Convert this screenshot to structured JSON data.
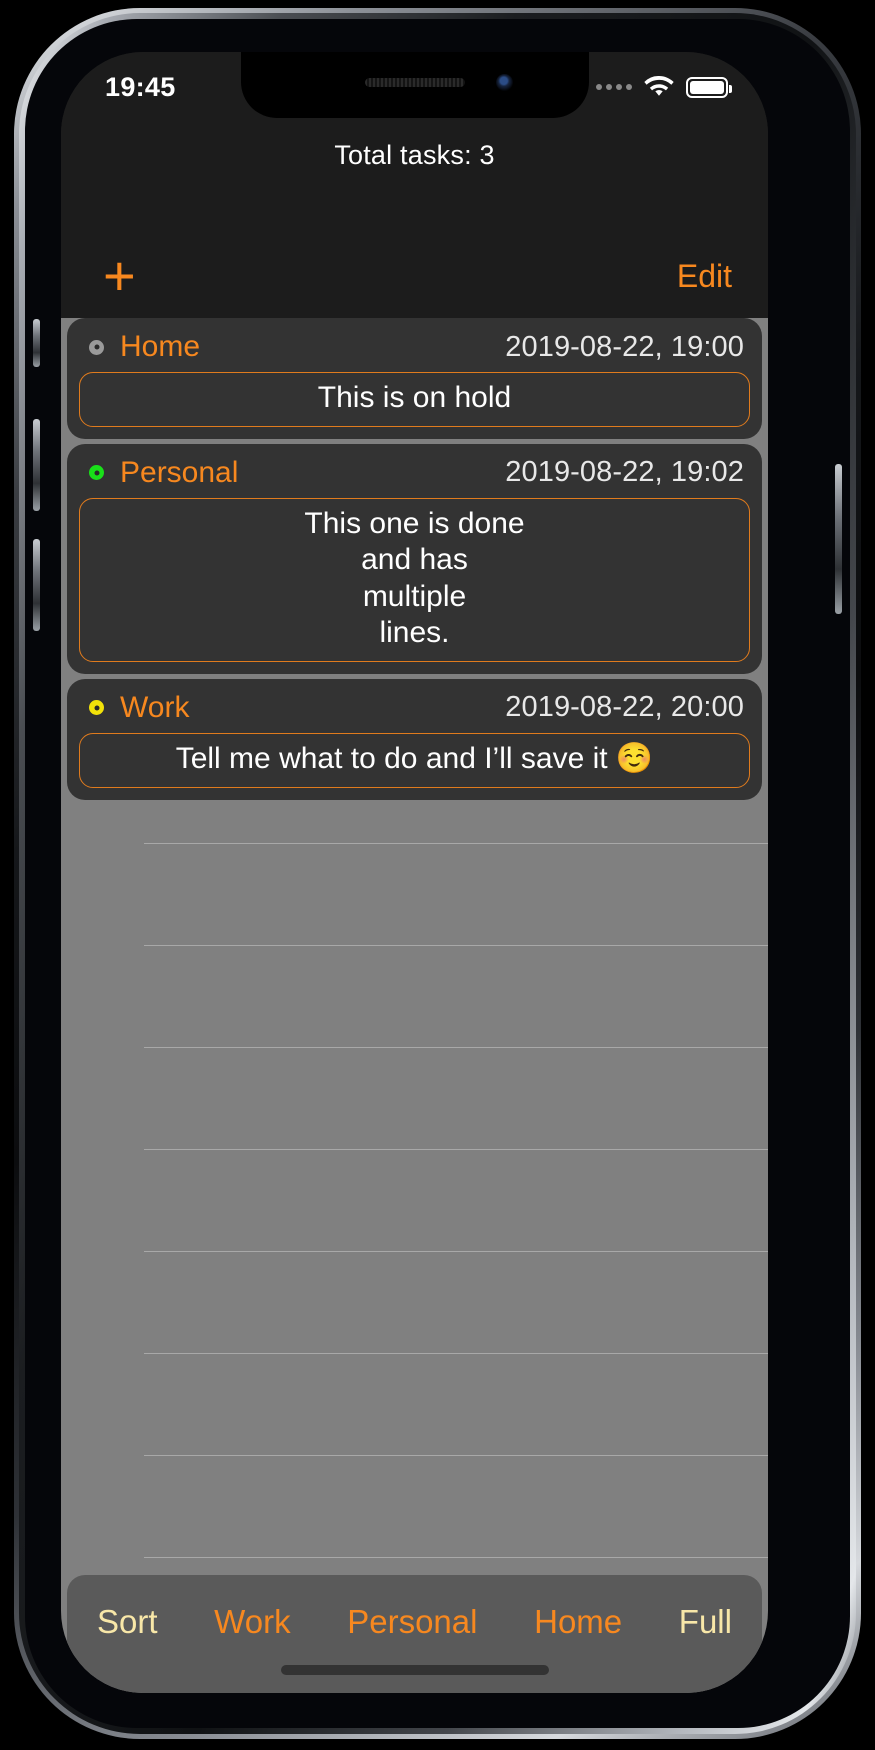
{
  "status_bar": {
    "time": "19:45",
    "cellular_icon": "cellular-dots-icon",
    "wifi_icon": "wifi-icon",
    "battery_icon": "battery-full-icon"
  },
  "header": {
    "title": "Total tasks: 3",
    "add_label": "+",
    "edit_label": "Edit"
  },
  "colors": {
    "accent_orange": "#f7881f",
    "note_border": "#e07b1d",
    "cream": "#f8e7a8",
    "status_hold": "#9a9a9a",
    "status_done": "#19e019",
    "status_active": "#f2e209",
    "card_bg": "#333333",
    "screen_bg": "#1c1c1c",
    "list_bg": "#808080",
    "tabbar_bg": "#5a5a5a"
  },
  "tasks": [
    {
      "status": "on-hold",
      "status_color": "#9a9a9a",
      "category": "Home",
      "date": "2019-08-22, 19:00",
      "note_lines": [
        "This is on hold"
      ]
    },
    {
      "status": "done",
      "status_color": "#19e019",
      "category": "Personal",
      "date": "2019-08-22, 19:02",
      "note_lines": [
        "This one is done",
        "and has",
        "multiple",
        "lines."
      ]
    },
    {
      "status": "active",
      "status_color": "#f2e209",
      "category": "Work",
      "date": "2019-08-22, 20:00",
      "note_lines": [
        "Tell me what to do and I’ll save it ☺️"
      ]
    }
  ],
  "tab_bar": {
    "items": [
      {
        "label": "Sort",
        "color": "#f8e7a8"
      },
      {
        "label": "Work",
        "color": "#f7881f"
      },
      {
        "label": "Personal",
        "color": "#f7881f"
      },
      {
        "label": "Home",
        "color": "#f7881f"
      },
      {
        "label": "Full",
        "color": "#f8e7a8"
      }
    ]
  }
}
